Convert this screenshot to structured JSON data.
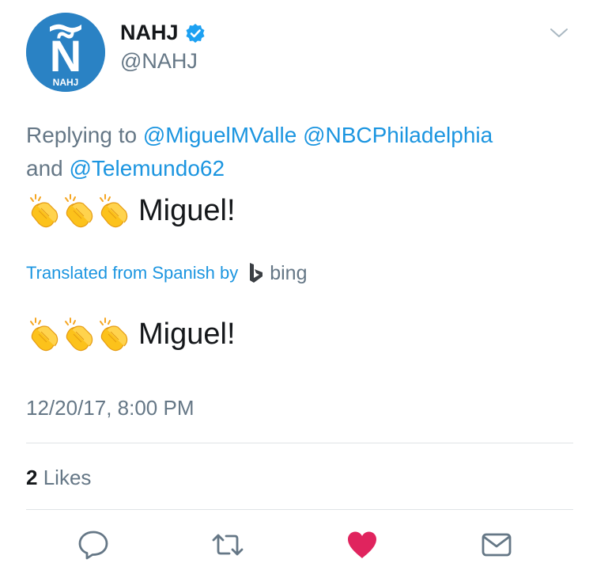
{
  "header": {
    "display_name": "NAHJ",
    "handle": "@NAHJ",
    "avatar_text": "NAHJ",
    "avatar_letter": "Ñ"
  },
  "reply": {
    "prefix": "Replying to",
    "mention1": "@MiguelMValle",
    "mention2": "@NBCPhiladelphia",
    "joiner": "and",
    "mention3": "@Telemundo62"
  },
  "tweet": {
    "text": "Miguel!",
    "translated_label": "Translated from Spanish by",
    "translator": "bing",
    "translated_text": "Miguel!",
    "timestamp": "12/20/17, 8:00 PM"
  },
  "stats": {
    "likes_count": "2",
    "likes_label": "Likes"
  },
  "icons": [
    "chevron-down-icon",
    "verified-icon",
    "clapping-hands-icon",
    "bing-logo-icon",
    "reply-icon",
    "retweet-icon",
    "like-heart-icon",
    "share-mail-icon"
  ],
  "colors": {
    "link": "#1b95e0",
    "muted": "#657786",
    "text": "#14171a",
    "like": "#e0245e",
    "avatar_bg": "#2a82c4"
  }
}
